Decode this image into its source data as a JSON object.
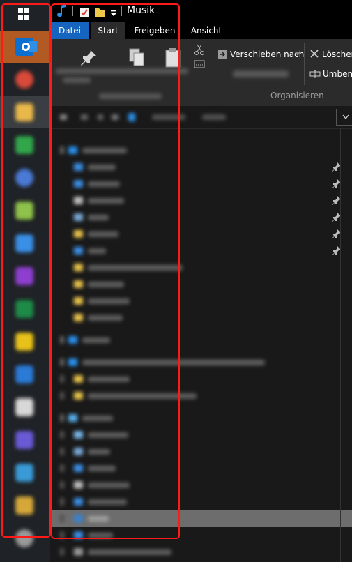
{
  "taskbar": {
    "start_icon": "windows-logo-icon",
    "apps": [
      {
        "icon": "outlook-icon",
        "color": "#0b6fd0",
        "state": "active"
      },
      {
        "icon": "chrome-icon",
        "color": "#d84a3a",
        "state": "normal"
      },
      {
        "icon": "file-explorer-icon",
        "color": "#e8b84a",
        "state": "open"
      },
      {
        "icon": "green-app-icon",
        "color": "#31a64b",
        "state": "normal"
      },
      {
        "icon": "globe-icon",
        "color": "#4a7ad6",
        "state": "normal"
      },
      {
        "icon": "notepad-icon",
        "color": "#8fc24a",
        "state": "normal"
      },
      {
        "icon": "mail-icon",
        "color": "#3a8fe6",
        "state": "normal"
      },
      {
        "icon": "onenote-icon",
        "color": "#8e3fd0",
        "state": "normal"
      },
      {
        "icon": "excel-icon",
        "color": "#1e8a48",
        "state": "normal"
      },
      {
        "icon": "sticky-notes-icon",
        "color": "#e8c21a",
        "state": "normal"
      },
      {
        "icon": "vscode-icon",
        "color": "#2a7ad6",
        "state": "normal"
      },
      {
        "icon": "document-icon",
        "color": "#d8d8d8",
        "state": "normal"
      },
      {
        "icon": "teams-icon",
        "color": "#6a5ad6",
        "state": "normal"
      },
      {
        "icon": "remote-desktop-icon",
        "color": "#3a9ad6",
        "state": "normal"
      },
      {
        "icon": "photo-app-icon",
        "color": "#d6a83a",
        "state": "normal"
      },
      {
        "icon": "settings-icon",
        "color": "#9a9a9a",
        "state": "normal"
      }
    ]
  },
  "titlebar": {
    "title": "Musik",
    "music_icon": "music-note-icon",
    "properties_icon": "properties-check-icon",
    "new_folder_icon": "folder-icon",
    "dropdown_icon": "chevron-down-icon"
  },
  "tabs": [
    {
      "label": "Datei",
      "kind": "file"
    },
    {
      "label": "Start",
      "kind": "selected"
    },
    {
      "label": "Freigeben",
      "kind": "normal"
    },
    {
      "label": "Ansicht",
      "kind": "normal"
    }
  ],
  "ribbon": {
    "move_to": "Verschieben nach",
    "delete": "Löschen",
    "rename": "Umbene",
    "group_organize": "Organisieren"
  },
  "colors": {
    "accent": "#1565c0",
    "highlight": "#ff1a1a",
    "taskbar_active": "#b25a24"
  }
}
